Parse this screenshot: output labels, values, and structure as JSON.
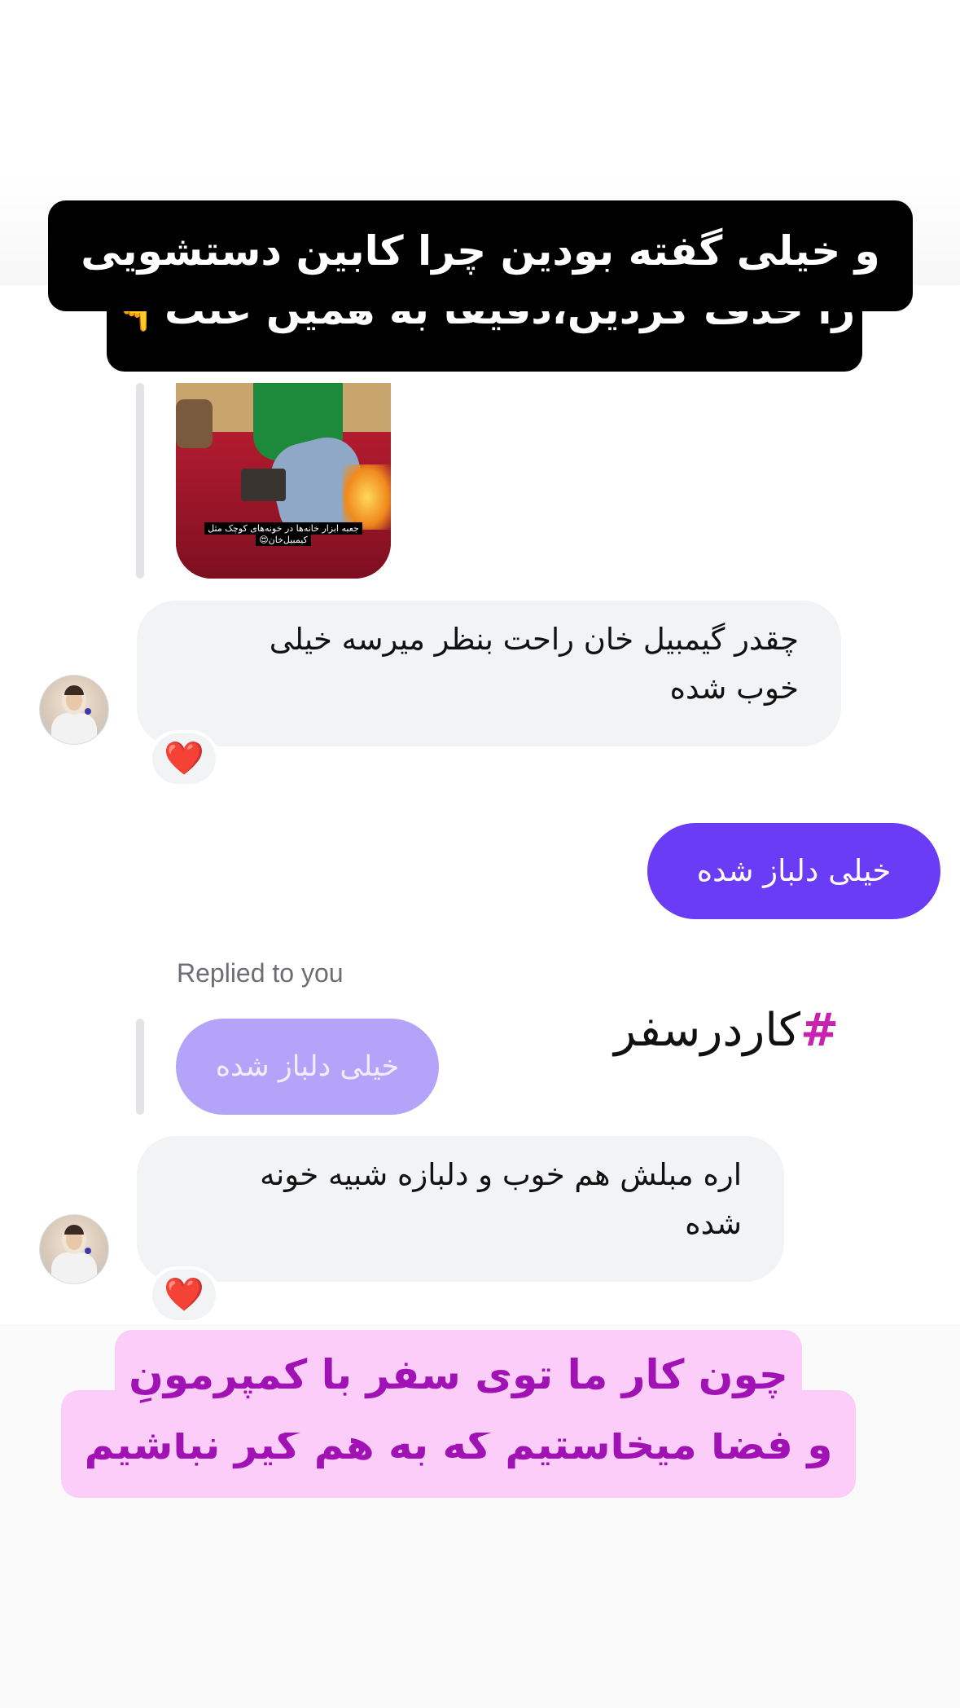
{
  "story_caption_top": {
    "line1": "و خیلی گفته بودین چرا کابین دستشویی",
    "line2": "را حذف کردین،دقیقا به همین علت👇"
  },
  "shared_post": {
    "image_caption_line1": "جعبه ابزار خانه‌ها در خونه‌های کوچک مثل",
    "image_caption_line2": "کیمبیل‌خان😍"
  },
  "messages": [
    {
      "direction": "incoming",
      "text_line1": "چقدر گیمبیل خان راحت بنظر میرسه خیلی",
      "text_line2": "خوب شده",
      "reaction": "❤️"
    },
    {
      "direction": "outgoing",
      "text": "خیلی دلباز شده"
    },
    {
      "direction": "incoming",
      "reply_label": "Replied to you",
      "quoted_text": "خیلی دلباز شده",
      "text_line1": "اره مبلش هم خوب و دلبازه شبیه خونه",
      "text_line2": "شده",
      "reaction": "❤️"
    }
  ],
  "hashtag": {
    "symbol": "#",
    "text": "کاردرسفر"
  },
  "story_caption_bottom": {
    "line1": "چون کار ما توی سفر با کمپرمونِ",
    "line2": "و فضا میخاستیم که به هم گیر نباشیم"
  },
  "colors": {
    "outgoing_bubble": "#6a3cf5",
    "incoming_bubble": "#f2f3f5",
    "quoted_bubble": "#b4a4f9",
    "pink_caption_bg": "#fbcdf8",
    "pink_caption_text": "#a012b4",
    "hashtag_symbol": "#c823ae"
  }
}
